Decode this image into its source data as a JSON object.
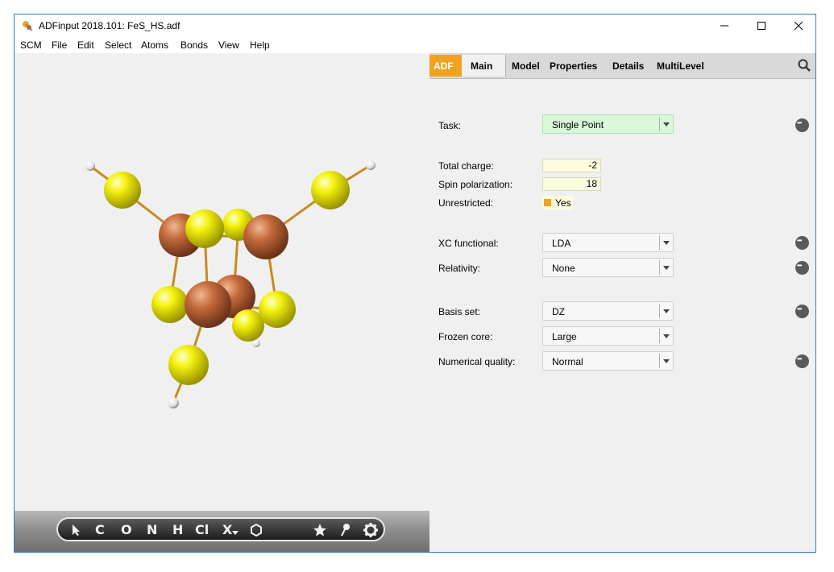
{
  "window": {
    "title": "ADFinput 2018.101: FeS_HS.adf"
  },
  "menu": [
    "SCM",
    "File",
    "Edit",
    "Select",
    "Atoms",
    "Bonds",
    "View",
    "Help"
  ],
  "tabs": {
    "engine": "ADF",
    "items": [
      "Main",
      "Model",
      "Properties",
      "Details",
      "MultiLevel"
    ]
  },
  "form": {
    "task": {
      "label": "Task:",
      "value": "Single Point"
    },
    "total_charge": {
      "label": "Total charge:",
      "value": "-2"
    },
    "spin_polarization": {
      "label": "Spin polarization:",
      "value": "18"
    },
    "unrestricted": {
      "label": "Unrestricted:",
      "value": "Yes"
    },
    "xc_functional": {
      "label": "XC functional:",
      "value": "LDA"
    },
    "relativity": {
      "label": "Relativity:",
      "value": "None"
    },
    "basis_set": {
      "label": "Basis set:",
      "value": "DZ"
    },
    "frozen_core": {
      "label": "Frozen core:",
      "value": "Large"
    },
    "numerical_quality": {
      "label": "Numerical quality:",
      "value": "Normal"
    }
  },
  "toolbar": {
    "elements": [
      "C",
      "O",
      "N",
      "H",
      "Cl",
      "X"
    ]
  },
  "colors": {
    "accent_orange": "#f3a21f",
    "iron": "#c46a3b",
    "sulfur": "#f5f20f",
    "hydrogen": "#ffffff",
    "task_bg": "#d8f8d8"
  }
}
